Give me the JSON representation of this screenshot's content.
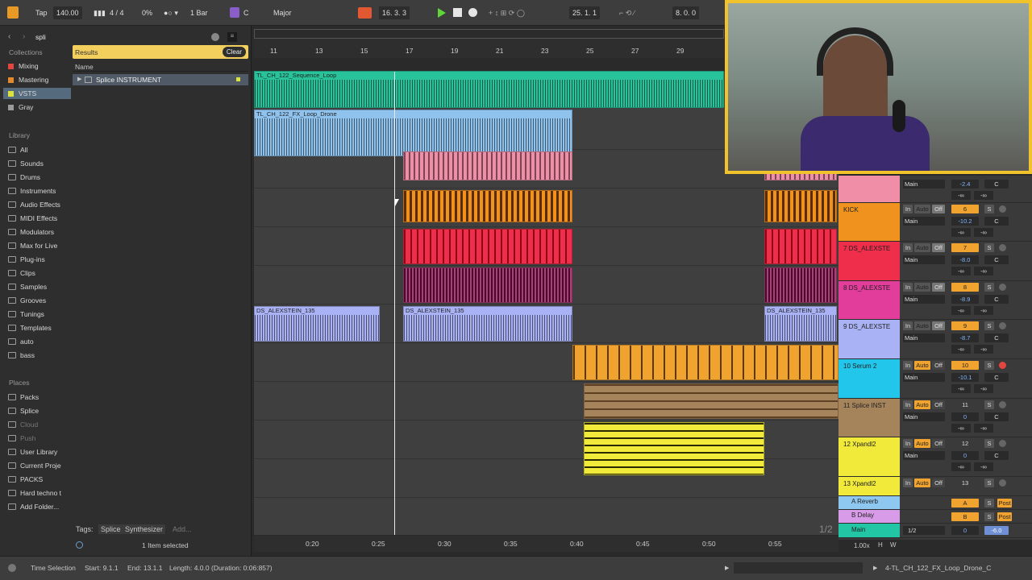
{
  "topbar": {
    "tap": "Tap",
    "bpm": "140.00",
    "signature": "4 / 4",
    "groove": "0%",
    "quantize": "1 Bar",
    "key": "C",
    "scale": "Major",
    "position": "16.  3.  3",
    "loop_start": "25.  1.  1",
    "loop_length": "8.  0.  0"
  },
  "browser": {
    "search": "spli",
    "results_label": "Results",
    "clear_label": "Clear",
    "name_header": "Name",
    "result_item": "Splice INSTRUMENT",
    "collections_title": "Collections",
    "collections": [
      {
        "label": "Mixing",
        "color": "#e2463e"
      },
      {
        "label": "Mastering",
        "color": "#e38a2d"
      },
      {
        "label": "VSTS",
        "color": "#dbe23b"
      },
      {
        "label": "Gray",
        "color": "#9a9a9a"
      }
    ],
    "library_title": "Library",
    "library": [
      "All",
      "Sounds",
      "Drums",
      "Instruments",
      "Audio Effects",
      "MIDI Effects",
      "Modulators",
      "Max for Live",
      "Plug-ins",
      "Clips",
      "Samples",
      "Grooves",
      "Tunings",
      "Templates",
      "auto",
      "bass"
    ],
    "places_title": "Places",
    "places": [
      "Packs",
      "Splice",
      "Cloud",
      "Push",
      "User Library",
      "Current Proje",
      "PACKS",
      "Hard techno t",
      "Add Folder..."
    ],
    "tags_label": "Tags:",
    "tags": [
      "Splice",
      "Synthesizer"
    ],
    "tag_add": "Add...",
    "selected_status": "1 Item selected"
  },
  "ruler": {
    "bars": [
      "11",
      "13",
      "15",
      "17",
      "19",
      "21",
      "23",
      "25",
      "27",
      "29"
    ],
    "times": [
      "0:20",
      "0:25",
      "0:30",
      "0:35",
      "0:40",
      "0:45",
      "0:50",
      "0:55"
    ]
  },
  "clips": {
    "seq": "TL_CH_122_Sequence_Loop",
    "fx": "TL_CH_122_FX_Loop_Drone",
    "alex": "DS_ALEXSTEIN_135"
  },
  "mixer": {
    "tracks": [
      {
        "name": "",
        "num": "",
        "vol": "-2.4",
        "color": "#f08ea8"
      },
      {
        "name": "KICK",
        "num": "6",
        "vol": "-10.2",
        "color": "#f0921e"
      },
      {
        "name": "7 DS_ALEXSTE",
        "num": "7",
        "vol": "-8.0",
        "color": "#ee2e4a"
      },
      {
        "name": "8 DS_ALEXSTE",
        "num": "8",
        "vol": "-8.9",
        "color": "#e33d9c"
      },
      {
        "name": "9 DS_ALEXSTE",
        "num": "9",
        "vol": "-8.7",
        "color": "#a9b2f4"
      },
      {
        "name": "10 Serum 2",
        "num": "10",
        "vol": "-10.1",
        "color": "#22c6ea"
      },
      {
        "name": "11 Splice INST",
        "num": "11",
        "vol": "0",
        "color": "#a5835b"
      },
      {
        "name": "12 Xpandl2",
        "num": "12",
        "vol": "0",
        "color": "#f1ea3a"
      },
      {
        "name": "13 Xpandl2",
        "num": "13",
        "vol": "",
        "color": "#f1ea3a"
      }
    ],
    "returns": [
      {
        "name": "A Reverb",
        "letter": "A",
        "color": "#8ec8f1"
      },
      {
        "name": "B Delay",
        "letter": "B",
        "color": "#d89be8"
      }
    ],
    "main": {
      "name": "Main",
      "ratio": "1/2",
      "vol": "0",
      "peak": "-6.0"
    },
    "out": "Main",
    "in": "In",
    "auto": "Auto",
    "off": "Off",
    "s": "S",
    "c": "C",
    "post": "Post",
    "minf": "-∞",
    "page": "1/2"
  },
  "statusbar": {
    "mode": "Time Selection",
    "start": "Start: 9.1.1",
    "end": "End: 13.1.1",
    "length": "Length: 4.0.0 (Duration: 0:06:857)",
    "zoom": "1.00x",
    "h": "H",
    "w": "W",
    "clip": "4-TL_CH_122_FX_Loop_Drone_C"
  }
}
